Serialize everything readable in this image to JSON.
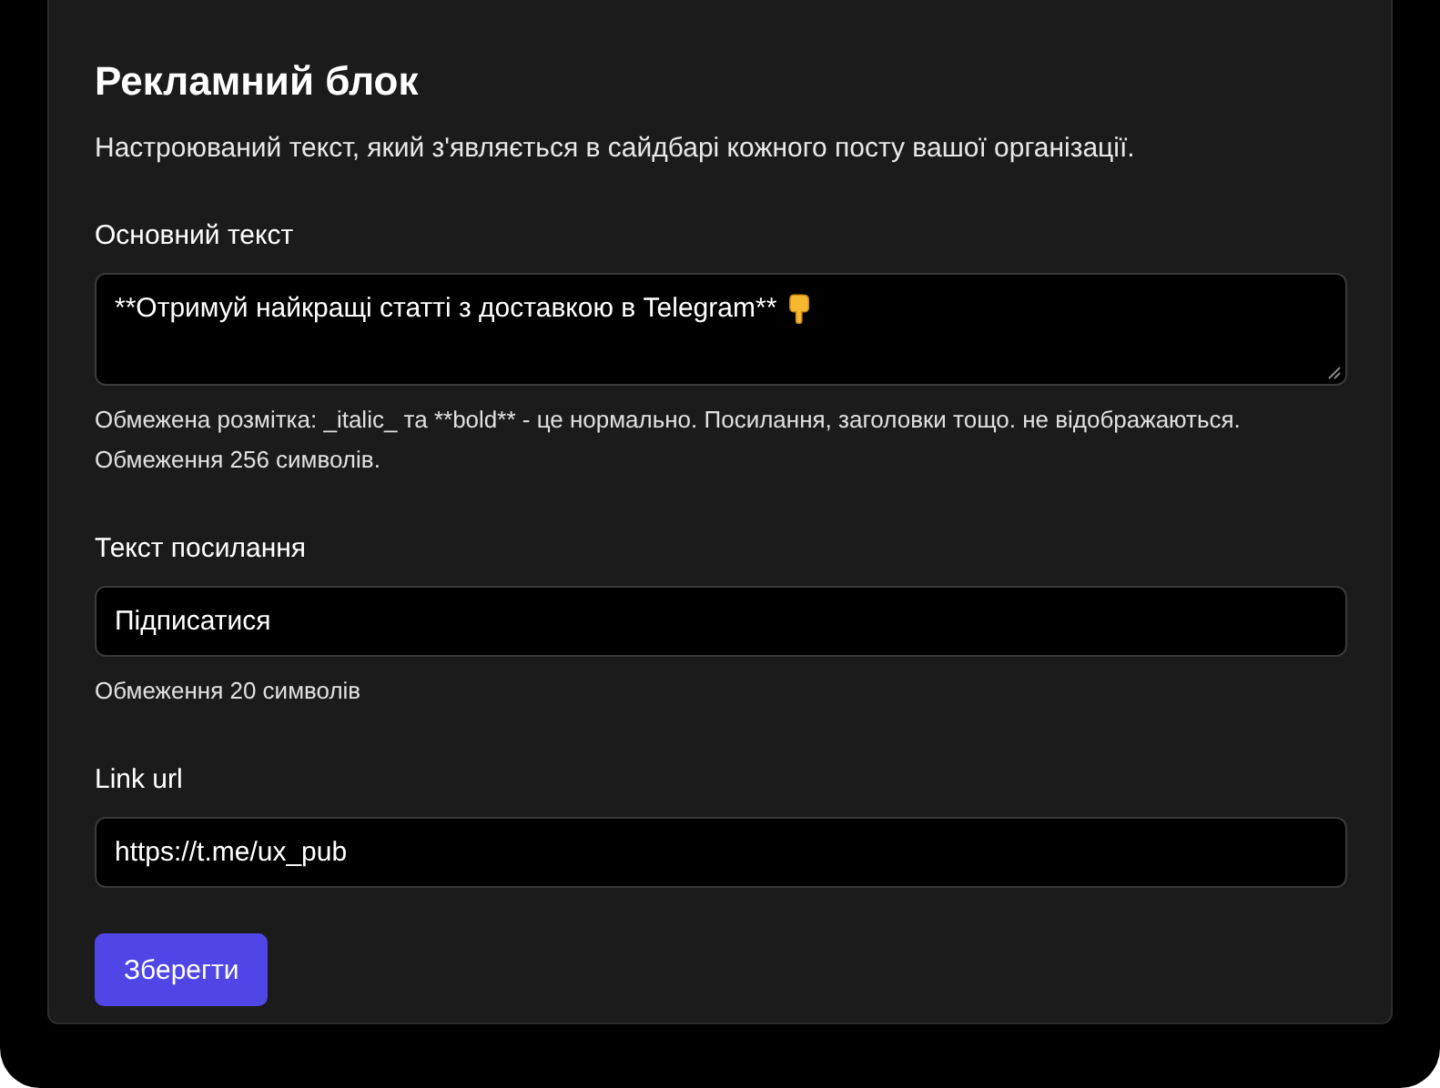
{
  "title": "Рекламний блок",
  "description": "Настроюваний текст, який з'являється в сайдбарі кожного посту вашої організації.",
  "fields": [
    {
      "kind": "textarea",
      "label": "Основний текст",
      "value": "**Отримуй найкращі статті з доставкою в Telegram**",
      "hint": "Обмежена розмітка: _italic_ та **bold** - це нормально. Посилання, заголовки тощо. не відображаються. Обмеження 256 символів."
    },
    {
      "kind": "input",
      "label": "Текст посилання",
      "value": "Підписатися",
      "hint": "Обмеження 20 символів"
    },
    {
      "kind": "input",
      "label": "Link url",
      "value": "https://t.me/ux_pub"
    }
  ],
  "button": "Зберегти"
}
